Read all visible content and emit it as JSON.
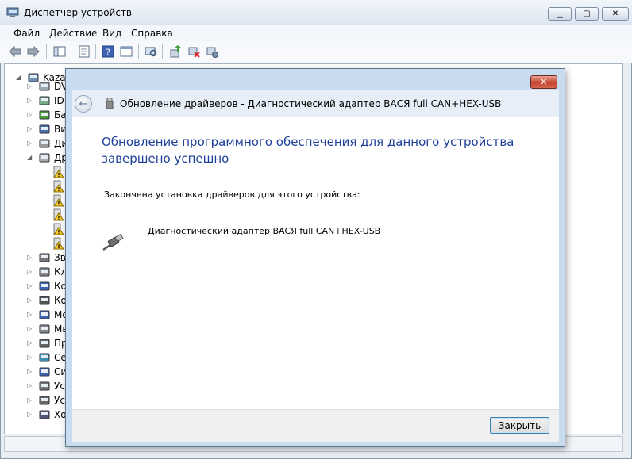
{
  "main_window": {
    "title": "Диспетчер устройств",
    "menu": [
      "Файл",
      "Действие",
      "Вид",
      "Справка"
    ],
    "toolbar_icons": [
      "back-icon",
      "forward-icon",
      "console-tree-icon",
      "properties-icon",
      "help-icon",
      "show-hide-icon",
      "scan-hardware-icon",
      "update-driver-icon",
      "uninstall-icon",
      "disable-icon"
    ],
    "tree": {
      "root_label": "Kazan",
      "items": [
        {
          "label": "DV",
          "icon": "dvd-icon"
        },
        {
          "label": "ID",
          "icon": "ide-icon"
        },
        {
          "label": "Ба",
          "icon": "battery-icon"
        },
        {
          "label": "Ви",
          "icon": "video-icon"
        },
        {
          "label": "Ди",
          "icon": "disk-icon"
        },
        {
          "label": "Др",
          "icon": "other-devices-icon"
        },
        {
          "label": "",
          "icon": "warning-device-icon"
        },
        {
          "label": "",
          "icon": "warning-device-icon"
        },
        {
          "label": "",
          "icon": "warning-device-icon"
        },
        {
          "label": "",
          "icon": "warning-device-icon"
        },
        {
          "label": "",
          "icon": "warning-device-icon"
        },
        {
          "label": "",
          "icon": "warning-device-icon"
        },
        {
          "label": "Зв",
          "icon": "sound-icon"
        },
        {
          "label": "Кл",
          "icon": "keyboard-icon"
        },
        {
          "label": "Ко",
          "icon": "computer-icon"
        },
        {
          "label": "Ко",
          "icon": "usb-controller-icon"
        },
        {
          "label": "Мо",
          "icon": "monitor-icon"
        },
        {
          "label": "Мы",
          "icon": "mouse-icon"
        },
        {
          "label": "Пр",
          "icon": "processor-icon"
        },
        {
          "label": "Се",
          "icon": "network-icon"
        },
        {
          "label": "Си",
          "icon": "system-icon"
        },
        {
          "label": "Ус",
          "icon": "hid-icon"
        },
        {
          "label": "Ус",
          "icon": "imaging-icon"
        },
        {
          "label": "Хо",
          "icon": "storage-icon"
        }
      ]
    }
  },
  "dialog": {
    "title": "Обновление драйверов - Диагностический адаптер ВАСЯ full CAN+HEX-USB",
    "heading": "Обновление программного обеспечения для данного устройства завершено успешно",
    "done_text": "Закончена установка драйверов для этого устройства:",
    "device_name": "Диагностический адаптер ВАСЯ full CAN+HEX-USB",
    "close_button": "Закрыть"
  },
  "colors": {
    "heading": "#1e3f9a",
    "dialog_close": "#c6452f"
  }
}
